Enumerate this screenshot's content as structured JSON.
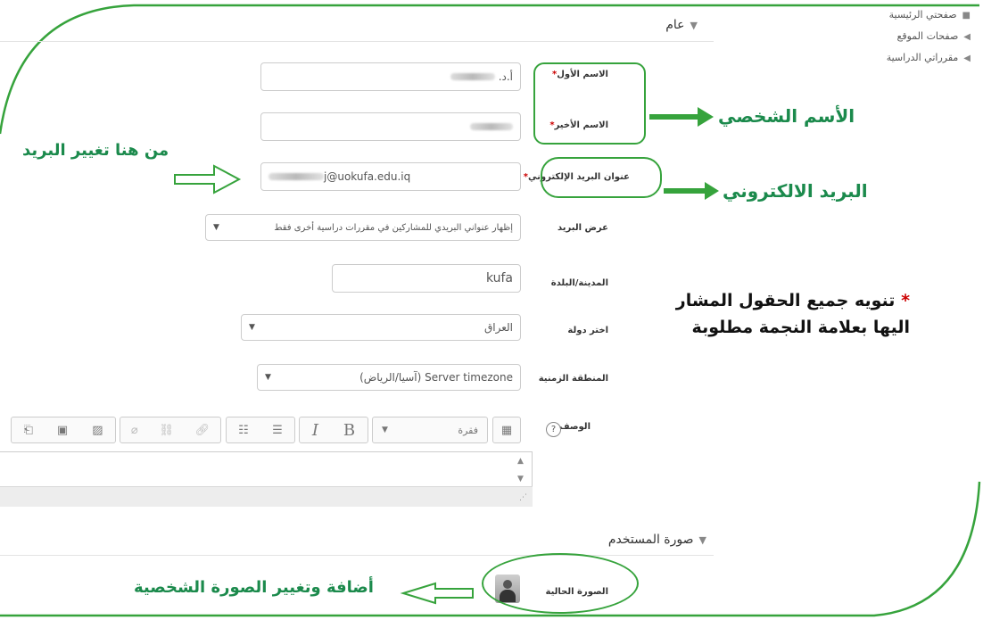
{
  "side_nav": {
    "items": [
      {
        "label": "صفحتي الرئيسية",
        "bullet": "■"
      },
      {
        "label": "صفحات الموقع",
        "bullet": "◀"
      },
      {
        "label": "مقرراتي الدراسية",
        "bullet": "◀"
      }
    ]
  },
  "sections": {
    "general": "عام",
    "user_picture": "صورة المستخدم"
  },
  "fields": {
    "first_name": {
      "label": "الاسم الأول",
      "required_mark": "*",
      "value_prefix": "أ.د."
    },
    "last_name": {
      "label": "الاسم الأخير",
      "required_mark": "*"
    },
    "email": {
      "label": "عنوان البريد الإلكتروني",
      "required_mark": "*",
      "value": "j@uokufa.edu.iq"
    },
    "email_display": {
      "label": "عرض البريد",
      "value": "إظهار عنواني البريدي للمشاركين في مقررات دراسية أخرى فقط"
    },
    "city": {
      "label": "المدينة/البلدة",
      "value": "kufa"
    },
    "country": {
      "label": "اختر دولة",
      "value": "العراق"
    },
    "timezone": {
      "label": "المنطقة الزمنية",
      "value": "Server timezone (آسيا/الرياض)"
    },
    "description": {
      "label": "الوصف",
      "help_icon": "?"
    },
    "current_picture": {
      "label": "الصورة الحالية"
    }
  },
  "editor": {
    "paragraph_label": "فقرة",
    "bold": "B",
    "italic": "I",
    "icons": [
      "toggle-toolbar-icon",
      "paragraph-dropdown-icon",
      "bold-icon",
      "italic-icon",
      "unordered-list-icon",
      "ordered-list-icon",
      "link-icon",
      "unlink-icon",
      "emoticon-icon",
      "image-icon",
      "media-icon",
      "manage-files-icon"
    ]
  },
  "annotations": {
    "personal_name": "الأسم الشخصي",
    "email": "البريد الالكتروني",
    "change_email_here": "من هنا تغيير البريد",
    "required_note_star": "*",
    "required_note_line1": "تنويه جميع الحقول المشار",
    "required_note_line2": "اليها بعلامة النجمة مطلوبة",
    "change_picture": "أضافة وتغيير الصورة الشخصية"
  },
  "colors": {
    "annotation_green": "#1b8a4c",
    "frame_green": "#36a33c",
    "required_red": "#cc0000"
  }
}
